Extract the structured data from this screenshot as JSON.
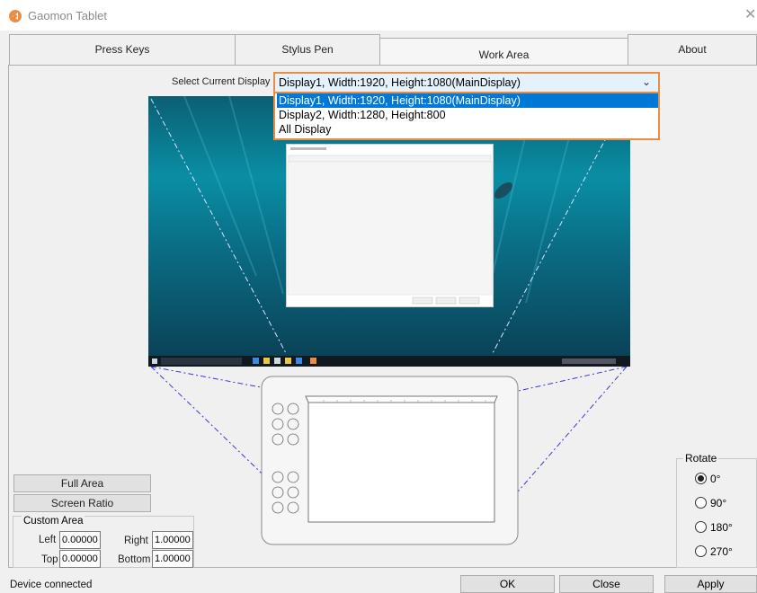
{
  "window": {
    "title": "Gaomon Tablet",
    "close_glyph": "✕"
  },
  "tabs": [
    {
      "label": "Press Keys",
      "active": false
    },
    {
      "label": "Stylus Pen",
      "active": false
    },
    {
      "label": "Work Area",
      "active": true
    },
    {
      "label": "About",
      "active": false
    }
  ],
  "display_select": {
    "label": "Select Current Display",
    "value": "Display1, Width:1920, Height:1080(MainDisplay)",
    "options": [
      "Display1, Width:1920, Height:1080(MainDisplay)",
      "Display2, Width:1280, Height:800",
      "All Display"
    ],
    "selected_index": 0
  },
  "area_buttons": {
    "full_area": "Full Area",
    "screen_ratio": "Screen Ratio"
  },
  "custom_area": {
    "title": "Custom Area",
    "left_label": "Left",
    "left_value": "0.00000",
    "right_label": "Right",
    "right_value": "1.00000",
    "top_label": "Top",
    "top_value": "0.00000",
    "bottom_label": "Bottom",
    "bottom_value": "1.00000"
  },
  "rotate": {
    "title": "Rotate",
    "options": [
      "0°",
      "90°",
      "180°",
      "270°"
    ],
    "selected_index": 0
  },
  "status": "Device connected",
  "footer_buttons": {
    "ok": "OK",
    "close": "Close",
    "apply": "Apply"
  },
  "colors": {
    "accent": "#e98d45",
    "selection": "#0078d7",
    "guide": "#3a3ad0"
  }
}
